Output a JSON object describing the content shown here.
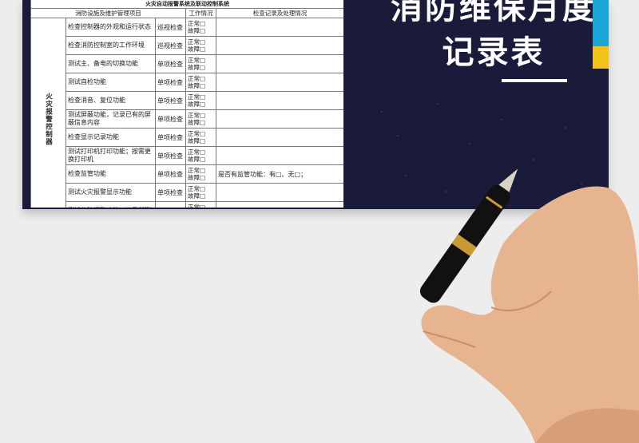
{
  "banner": {
    "title_line1": "消防维保月度",
    "title_line2": "记录表",
    "colors": {
      "background": "#1a1a3a",
      "accent_cyan": "#1aa6d6",
      "accent_yellow": "#f2c318"
    }
  },
  "sheet": {
    "caption": "火灾自动报警系统及联动控制系统",
    "headers": [
      "消防设施及维护管理项目",
      "工作情况",
      "检查记录及处理情况"
    ],
    "group_label": "火灾报警控制器",
    "status_labels": {
      "normal": "正常□",
      "fault": "故障□"
    },
    "rows": [
      {
        "item": "检查控制器的外观和运行状态",
        "method": "巡视检查",
        "record": ""
      },
      {
        "item": "检查消防控制室的工作环境",
        "method": "巡视检查",
        "record": ""
      },
      {
        "item": "测试主、备电的切换功能",
        "method": "单项检查",
        "record": ""
      },
      {
        "item": "测试自检功能",
        "method": "单项检查",
        "record": ""
      },
      {
        "item": "检查消音、复位功能",
        "method": "单项检查",
        "record": ""
      },
      {
        "item": "测试屏蔽功能，记录已有的屏蔽信息内容",
        "method": "单项检查",
        "record": ""
      },
      {
        "item": "检查显示记录功能",
        "method": "单项检查",
        "record": ""
      },
      {
        "item": "测试打印机打印功能；按需更换打印机",
        "method": "单项检查",
        "record": ""
      },
      {
        "item": "检查监管功能",
        "method": "单项检查",
        "record": "是否有监管功能：有□、无□；"
      },
      {
        "item": "测试火灾报警显示功能",
        "method": "单项检查",
        "record": ""
      },
      {
        "item": "测试故障报警功能；记录所测",
        "method": "单项检查",
        "record": ""
      }
    ]
  }
}
